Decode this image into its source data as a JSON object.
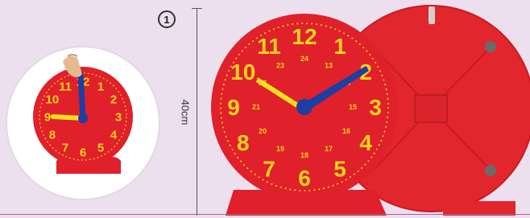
{
  "badge": {
    "label": "1"
  },
  "dimension": {
    "label": "40cm"
  },
  "colors": {
    "background": "#ece0ee",
    "clock_face": "#e8202a",
    "numerals": "#f5d41e",
    "hour_hand": "#f2e01e",
    "minute_hand": "#1b3fa3",
    "accent_line": "#a6619a"
  },
  "small_clock": {
    "numerals": [
      "12",
      "1",
      "2",
      "3",
      "4",
      "5",
      "6",
      "7",
      "8",
      "9",
      "10",
      "11"
    ]
  },
  "main_clock": {
    "numerals": [
      "12",
      "1",
      "2",
      "3",
      "4",
      "5",
      "6",
      "7",
      "8",
      "9",
      "10",
      "11"
    ],
    "inner_numerals": [
      "24",
      "13",
      "14",
      "15",
      "16",
      "17",
      "18",
      "19",
      "20",
      "21",
      "22",
      "23"
    ]
  }
}
